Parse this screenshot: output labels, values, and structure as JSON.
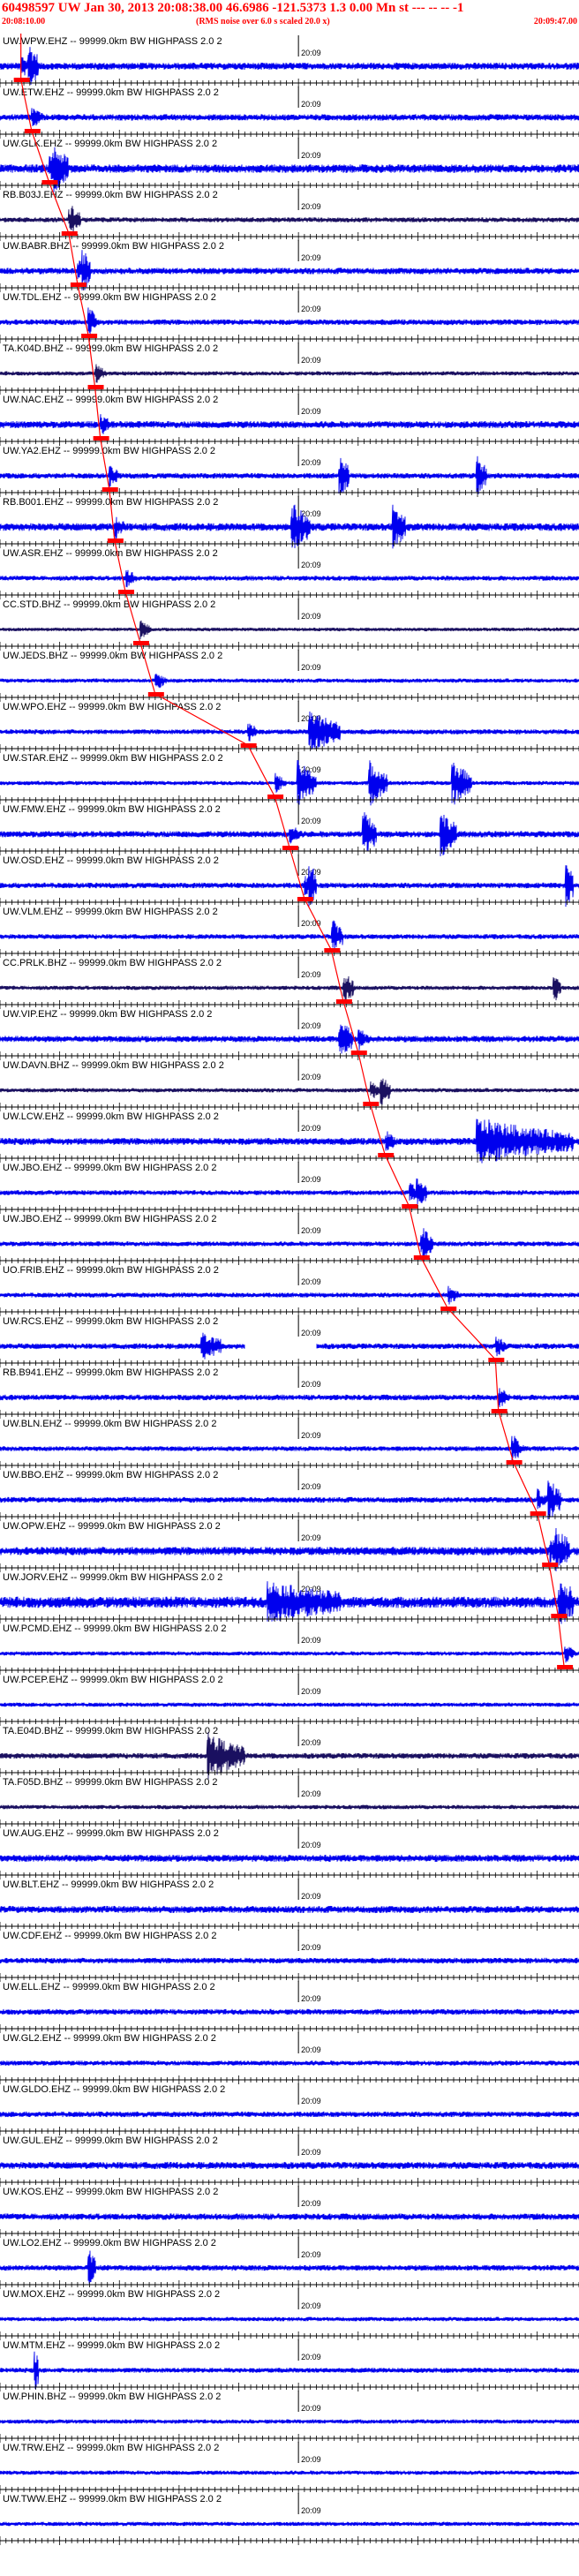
{
  "header": {
    "title": "60498597 UW Jan 30, 2013 20:08:38.00   46.6986 -121.5373  1.3 0.00 Mn st --- -- --   -1",
    "start_time": "20:08:10.00",
    "note": "(RMS noise over 6.0 s scaled 20.0 x)",
    "end_time": "20:09:47.00"
  },
  "colors": {
    "trace_blue": "#0000ee",
    "trace_dark": "#1a1060",
    "pick_red": "#ff0000",
    "axis": "#000000"
  },
  "chart_data": {
    "type": "seismogram",
    "minute_label": "20:09",
    "time_range_s": [
      0,
      97
    ],
    "minute_mark_s": 50,
    "channels": [
      {
        "label": "UW.WPW.EHZ -- 99999.0km BW  HIGHPASS  2.0  2",
        "pick_s": 3.5,
        "amp": 0.5,
        "color": "blue",
        "bursts": [
          [
            5,
            0.9,
            1.5
          ]
        ]
      },
      {
        "label": "UW.ETW.EHZ -- 99999.0km BW  HIGHPASS  2.0  2",
        "pick_s": 5.3,
        "amp": 0.45,
        "color": "blue",
        "bursts": []
      },
      {
        "label": "UW.GLK.EHZ -- 99999.0km BW  HIGHPASS  2.0  2",
        "pick_s": 8.2,
        "amp": 0.6,
        "color": "blue",
        "bursts": [
          [
            9,
            1.0,
            2.5
          ]
        ]
      },
      {
        "label": "RB.B03J.EHZ -- 99999.0km BW  HIGHPASS  2.0  2",
        "pick_s": 11.5,
        "amp": 0.35,
        "color": "dark",
        "bursts": [
          [
            12,
            0.6,
            1.5
          ]
        ]
      },
      {
        "label": "UW.BABR.BHZ -- 99999.0km BW  HIGHPASS  2.0  2",
        "pick_s": 13.0,
        "amp": 0.45,
        "color": "blue",
        "bursts": [
          [
            14,
            0.9,
            1.2
          ]
        ]
      },
      {
        "label": "UW.TDL.EHZ -- 99999.0km BW  HIGHPASS  2.0  2",
        "pick_s": 14.8,
        "amp": 0.4,
        "color": "blue",
        "bursts": [
          [
            15,
            0.6,
            1.0
          ]
        ]
      },
      {
        "label": "TA.K04D.BHZ -- 99999.0km BW  HIGHPASS  2.0  2",
        "pick_s": 15.9,
        "amp": 0.3,
        "color": "dark",
        "bursts": []
      },
      {
        "label": "UW.NAC.EHZ -- 99999.0km BW  HIGHPASS  2.0  2",
        "pick_s": 16.8,
        "amp": 0.5,
        "color": "blue",
        "bursts": []
      },
      {
        "label": "UW.YA2.EHZ -- 99999.0km BW  HIGHPASS  2.0  2",
        "pick_s": 18.3,
        "amp": 0.4,
        "color": "blue",
        "bursts": [
          [
            57,
            0.9,
            1.5
          ],
          [
            80,
            0.8,
            1.5
          ]
        ]
      },
      {
        "label": "RB.B001.EHZ -- 99999.0km BW  HIGHPASS  2.0  2",
        "pick_s": 19.2,
        "amp": 0.55,
        "color": "blue",
        "bursts": [
          [
            49,
            1.0,
            3.0
          ],
          [
            66,
            0.9,
            2.0
          ]
        ]
      },
      {
        "label": "UW.ASR.EHZ -- 99999.0km BW  HIGHPASS  2.0  2",
        "pick_s": 21.0,
        "amp": 0.35,
        "color": "blue",
        "bursts": []
      },
      {
        "label": "CC.STD.BHZ -- 99999.0km BW  HIGHPASS  2.0  2",
        "pick_s": 23.5,
        "amp": 0.25,
        "color": "dark",
        "bursts": []
      },
      {
        "label": "UW.JEDS.BHZ -- 99999.0km BW  HIGHPASS  2.0  2",
        "pick_s": 26.0,
        "amp": 0.3,
        "color": "blue",
        "bursts": []
      },
      {
        "label": "UW.WPO.EHZ -- 99999.0km BW  HIGHPASS  2.0  2",
        "pick_s": 41.5,
        "amp": 0.35,
        "color": "blue",
        "bursts": [
          [
            52,
            1.0,
            5.0
          ]
        ]
      },
      {
        "label": "UW.STAR.EHZ -- 99999.0km BW  HIGHPASS  2.0  2",
        "pick_s": 46.0,
        "amp": 0.3,
        "color": "blue",
        "bursts": [
          [
            50,
            1.0,
            3.0
          ],
          [
            62,
            1.0,
            3.0
          ],
          [
            76,
            1.0,
            3.0
          ]
        ]
      },
      {
        "label": "UW.FMW.EHZ -- 99999.0km BW  HIGHPASS  2.0  2",
        "pick_s": 48.5,
        "amp": 0.45,
        "color": "blue",
        "bursts": [
          [
            61,
            1.0,
            2.0
          ],
          [
            74,
            1.0,
            2.5
          ]
        ]
      },
      {
        "label": "UW.OSD.EHZ -- 99999.0km BW  HIGHPASS  2.0  2",
        "pick_s": 51.0,
        "amp": 0.4,
        "color": "blue",
        "bursts": [
          [
            52,
            1.0,
            1.0
          ],
          [
            95,
            1.0,
            1.0
          ]
        ]
      },
      {
        "label": "UW.VLM.EHZ -- 99999.0km BW  HIGHPASS  2.0  2",
        "pick_s": 55.5,
        "amp": 0.35,
        "color": "blue",
        "bursts": [
          [
            56,
            0.7,
            1.5
          ]
        ]
      },
      {
        "label": "CC.PRLK.BHZ -- 99999.0km BW  HIGHPASS  2.0  2",
        "pick_s": 57.5,
        "amp": 0.3,
        "color": "dark",
        "bursts": [
          [
            58,
            0.6,
            1.2
          ],
          [
            93,
            0.6,
            1.0
          ]
        ]
      },
      {
        "label": "UW.VIP.EHZ -- 99999.0km BW  HIGHPASS  2.0  2",
        "pick_s": 60.0,
        "amp": 0.45,
        "color": "blue",
        "bursts": [
          [
            57,
            0.8,
            2.0
          ]
        ]
      },
      {
        "label": "UW.DAVN.BHZ -- 99999.0km BW  HIGHPASS  2.0  2",
        "pick_s": 62.0,
        "amp": 0.3,
        "color": "dark",
        "bursts": [
          [
            64,
            0.6,
            1.5
          ]
        ]
      },
      {
        "label": "UW.LCW.EHZ -- 99999.0km BW  HIGHPASS  2.0  2",
        "pick_s": 64.5,
        "amp": 0.5,
        "color": "blue",
        "bursts": [
          [
            80,
            1.0,
            16.0
          ]
        ]
      },
      {
        "label": "UW.JBO.EHZ -- 99999.0km BW  HIGHPASS  2.0  2",
        "pick_s": 68.5,
        "amp": 0.35,
        "color": "blue",
        "bursts": [
          [
            70,
            0.6,
            1.5
          ]
        ]
      },
      {
        "label": "UW.JBO.EHZ -- 99999.0km BW  HIGHPASS  2.0  2",
        "pick_s": 70.5,
        "amp": 0.35,
        "color": "blue",
        "bursts": [
          [
            71,
            0.7,
            1.5
          ]
        ]
      },
      {
        "label": "UO.FRIB.EHZ -- 99999.0km BW  HIGHPASS  2.0  2",
        "pick_s": 75.0,
        "amp": 0.35,
        "color": "blue",
        "bursts": []
      },
      {
        "label": "UW.RCS.EHZ -- 99999.0km BW  HIGHPASS  2.0  2",
        "pick_s": 83.0,
        "amp": 0.4,
        "color": "blue",
        "bursts": [
          [
            34,
            0.6,
            3.0
          ]
        ],
        "gap": [
          41,
          53
        ]
      },
      {
        "label": "RB.B941.EHZ -- 99999.0km BW  HIGHPASS  2.0  2",
        "pick_s": 83.5,
        "amp": 0.4,
        "color": "blue",
        "bursts": []
      },
      {
        "label": "UW.BLN.EHZ -- 99999.0km BW  HIGHPASS  2.0  2",
        "pick_s": 86.0,
        "amp": 0.35,
        "color": "blue",
        "bursts": [
          [
            86,
            0.6,
            1.0
          ]
        ]
      },
      {
        "label": "UW.BBO.EHZ -- 99999.0km BW  HIGHPASS  2.0  2",
        "pick_s": 90.0,
        "amp": 0.4,
        "color": "blue",
        "bursts": [
          [
            92,
            0.9,
            2.0
          ]
        ]
      },
      {
        "label": "UW.OPW.EHZ -- 99999.0km BW  HIGHPASS  2.0  2",
        "pick_s": 92.0,
        "amp": 0.6,
        "color": "blue",
        "bursts": [
          [
            93,
            1.0,
            2.5
          ]
        ]
      },
      {
        "label": "UW.JORV.EHZ -- 99999.0km BW  HIGHPASS  2.0  2",
        "pick_s": 93.5,
        "amp": 0.8,
        "color": "blue",
        "bursts": [
          [
            45,
            0.8,
            12.0
          ],
          [
            94,
            1.0,
            2.0
          ]
        ]
      },
      {
        "label": "UW.PCMD.EHZ -- 99999.0km BW  HIGHPASS  2.0  2",
        "pick_s": 94.5,
        "amp": 0.3,
        "color": "blue",
        "bursts": []
      },
      {
        "label": "UW.PCEP.EHZ -- 99999.0km BW  HIGHPASS  2.0  2",
        "pick_s": null,
        "amp": 0.3,
        "color": "blue",
        "bursts": []
      },
      {
        "label": "TA.E04D.BHZ -- 99999.0km BW  HIGHPASS  2.0  2",
        "pick_s": null,
        "amp": 0.4,
        "color": "dark",
        "bursts": [
          [
            35,
            1.0,
            6.0
          ]
        ]
      },
      {
        "label": "TA.F05D.BHZ -- 99999.0km BW  HIGHPASS  2.0  2",
        "pick_s": null,
        "amp": 0.3,
        "color": "dark",
        "bursts": []
      },
      {
        "label": "UW.AUG.EHZ -- 99999.0km BW  HIGHPASS  2.0  2",
        "pick_s": null,
        "amp": 0.5,
        "color": "blue",
        "bursts": []
      },
      {
        "label": "UW.BLT.EHZ -- 99999.0km BW  HIGHPASS  2.0  2",
        "pick_s": null,
        "amp": 0.5,
        "color": "blue",
        "bursts": []
      },
      {
        "label": "UW.CDF.EHZ -- 99999.0km BW  HIGHPASS  2.0  2",
        "pick_s": null,
        "amp": 0.4,
        "color": "blue",
        "bursts": []
      },
      {
        "label": "UW.ELL.EHZ -- 99999.0km BW  HIGHPASS  2.0  2",
        "pick_s": null,
        "amp": 0.4,
        "color": "blue",
        "bursts": []
      },
      {
        "label": "UW.GL2.EHZ -- 99999.0km BW  HIGHPASS  2.0  2",
        "pick_s": null,
        "amp": 0.35,
        "color": "blue",
        "bursts": []
      },
      {
        "label": "UW.GLDO.EHZ -- 99999.0km BW  HIGHPASS  2.0  2",
        "pick_s": null,
        "amp": 0.4,
        "color": "blue",
        "bursts": []
      },
      {
        "label": "UW.GUL.EHZ -- 99999.0km BW  HIGHPASS  2.0  2",
        "pick_s": null,
        "amp": 0.5,
        "color": "blue",
        "bursts": []
      },
      {
        "label": "UW.KOS.EHZ -- 99999.0km BW  HIGHPASS  2.0  2",
        "pick_s": null,
        "amp": 0.45,
        "color": "blue",
        "bursts": []
      },
      {
        "label": "UW.LO2.EHZ -- 99999.0km BW  HIGHPASS  2.0  2",
        "pick_s": null,
        "amp": 0.4,
        "color": "blue",
        "bursts": [
          [
            15,
            0.9,
            1.0
          ]
        ]
      },
      {
        "label": "UW.MOX.EHZ -- 99999.0km BW  HIGHPASS  2.0  2",
        "pick_s": null,
        "amp": 0.3,
        "color": "blue",
        "bursts": []
      },
      {
        "label": "UW.MTM.EHZ -- 99999.0km BW  HIGHPASS  2.0  2",
        "pick_s": null,
        "amp": 0.35,
        "color": "blue",
        "bursts": [
          [
            6,
            1.0,
            0.5
          ]
        ]
      },
      {
        "label": "UW.PHIN.BHZ -- 99999.0km BW  HIGHPASS  2.0  2",
        "pick_s": null,
        "amp": 0.3,
        "color": "blue",
        "bursts": []
      },
      {
        "label": "UW.TRW.EHZ -- 99999.0km BW  HIGHPASS  2.0  2",
        "pick_s": null,
        "amp": 0.3,
        "color": "blue",
        "bursts": []
      },
      {
        "label": "UW.TWW.EHZ -- 99999.0km BW  HIGHPASS  2.0  2",
        "pick_s": null,
        "amp": 0.3,
        "color": "blue",
        "bursts": []
      }
    ]
  }
}
